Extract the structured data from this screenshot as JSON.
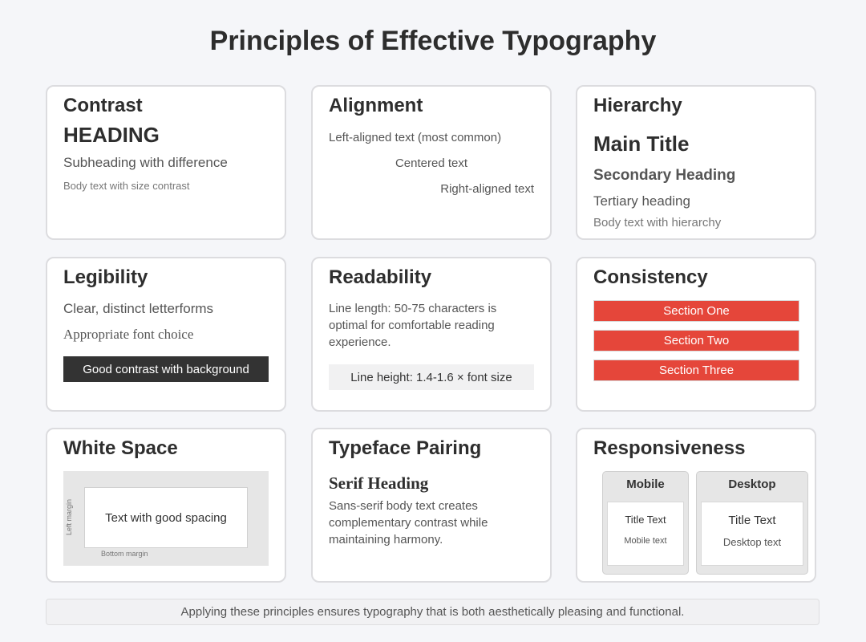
{
  "title": "Principles of Effective Typography",
  "cards": {
    "contrast": {
      "title": "Contrast",
      "heading": "HEADING",
      "subheading": "Subheading with difference",
      "body": "Body text with size contrast"
    },
    "alignment": {
      "title": "Alignment",
      "left": "Left-aligned text (most common)",
      "center": "Centered text",
      "right": "Right-aligned text"
    },
    "hierarchy": {
      "title": "Hierarchy",
      "main": "Main Title",
      "secondary": "Secondary Heading",
      "tertiary": "Tertiary heading",
      "body": "Body text with hierarchy"
    },
    "legibility": {
      "title": "Legibility",
      "line1": "Clear, distinct letterforms",
      "line2": "Appropriate font choice",
      "contrast_box": "Good contrast with background"
    },
    "readability": {
      "title": "Readability",
      "paragraph": "Line length: 50-75 characters is optimal for comfortable reading experience.",
      "line_height": "Line height: 1.4-1.6 × font size"
    },
    "consistency": {
      "title": "Consistency",
      "sections": [
        "Section One",
        "Section Two",
        "Section Three"
      ],
      "accent_color": "#e5463a"
    },
    "white_space": {
      "title": "White Space",
      "inner_text": "Text with good spacing",
      "left_margin_label": "Left margin",
      "bottom_margin_label": "Bottom margin"
    },
    "typeface_pairing": {
      "title": "Typeface Pairing",
      "serif_heading": "Serif Heading",
      "paragraph": "Sans-serif body text creates complementary contrast while maintaining harmony."
    },
    "responsiveness": {
      "title": "Responsiveness",
      "mobile": {
        "label": "Mobile",
        "title": "Title Text",
        "text": "Mobile text"
      },
      "desktop": {
        "label": "Desktop",
        "title": "Title Text",
        "text": "Desktop text"
      }
    }
  },
  "footer": "Applying these principles ensures typography that is both aesthetically pleasing and functional."
}
